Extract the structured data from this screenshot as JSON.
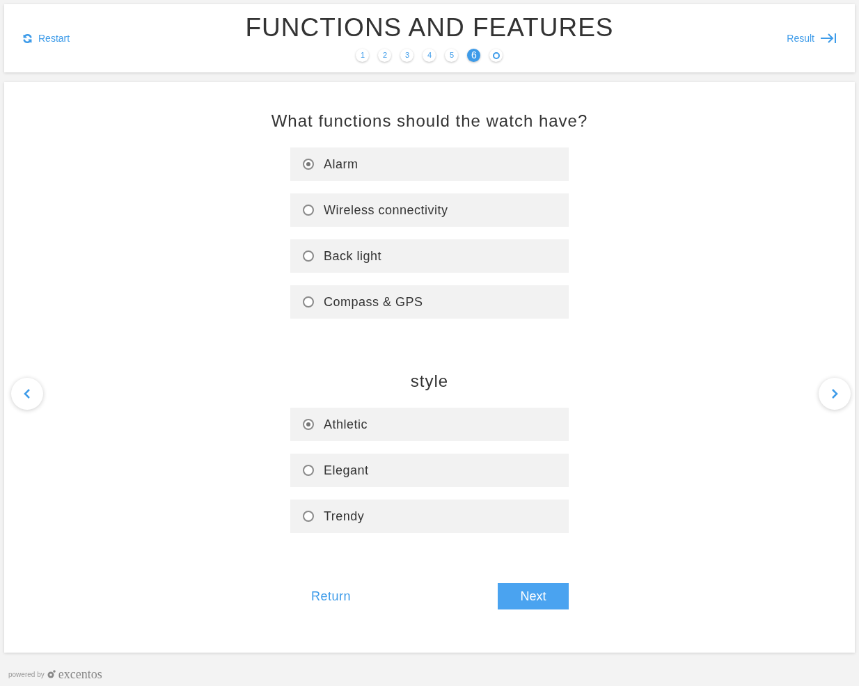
{
  "header": {
    "title": "FUNCTIONS AND FEATURES",
    "restart": "Restart",
    "result": "Result",
    "steps": [
      {
        "kind": "number",
        "label": "1",
        "selected": false
      },
      {
        "kind": "number",
        "label": "2",
        "selected": false
      },
      {
        "kind": "number",
        "label": "3",
        "selected": false
      },
      {
        "kind": "number",
        "label": "4",
        "selected": false
      },
      {
        "kind": "number",
        "label": "5",
        "selected": false
      },
      {
        "kind": "number",
        "label": "6",
        "selected": true
      },
      {
        "kind": "end",
        "selected": false
      }
    ]
  },
  "questions": [
    {
      "title": "What functions should the watch have?",
      "options": [
        {
          "label": "Alarm",
          "selected": true
        },
        {
          "label": "Wireless connectivity",
          "selected": false
        },
        {
          "label": "Back light",
          "selected": false
        },
        {
          "label": "Compass & GPS",
          "selected": false
        }
      ]
    },
    {
      "title": "style",
      "options": [
        {
          "label": "Athletic",
          "selected": true
        },
        {
          "label": "Elegant",
          "selected": false
        },
        {
          "label": "Trendy",
          "selected": false
        }
      ]
    }
  ],
  "actions": {
    "return": "Return",
    "next": "Next"
  },
  "footer": {
    "powered": "powered by",
    "brand": "excentos"
  }
}
